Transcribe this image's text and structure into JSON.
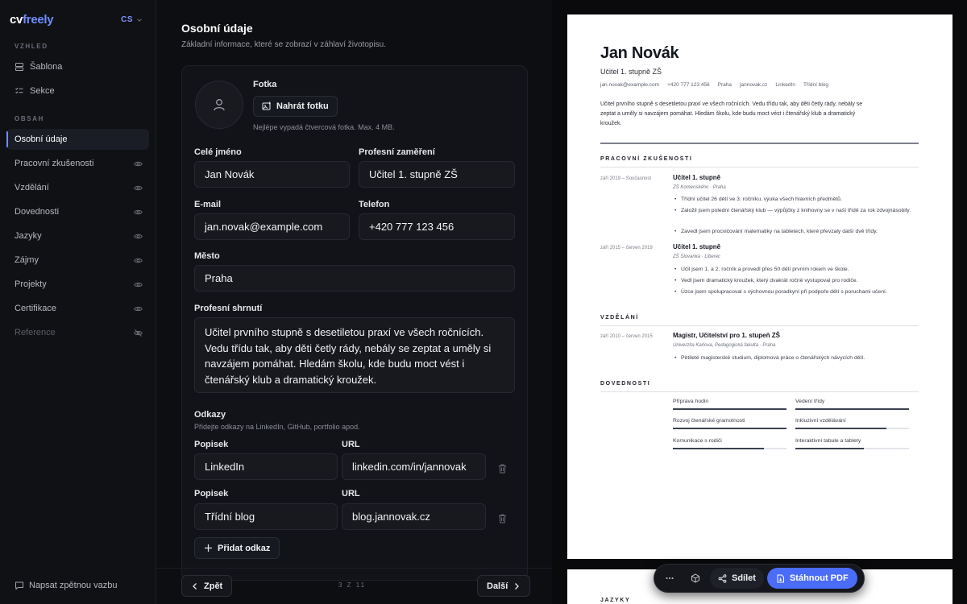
{
  "sidebar": {
    "brand_a": "cv",
    "brand_b": "freely",
    "lang": "CS",
    "section_look": "VZHLED",
    "section_content": "OBSAH",
    "look_items": [
      {
        "label": "Šablona",
        "icon": "layout-icon"
      },
      {
        "label": "Sekce",
        "icon": "list-check-icon"
      }
    ],
    "content_items": [
      {
        "label": "Osobní údaje",
        "active": true
      },
      {
        "label": "Pracovní zkušenosti"
      },
      {
        "label": "Vzdělání"
      },
      {
        "label": "Dovednosti"
      },
      {
        "label": "Jazyky"
      },
      {
        "label": "Zájmy"
      },
      {
        "label": "Projekty"
      },
      {
        "label": "Certifikace"
      },
      {
        "label": "Reference",
        "hidden": true
      }
    ],
    "feedback": "Napsat zpětnou vazbu"
  },
  "editor": {
    "title": "Osobní údaje",
    "subtitle": "Základní informace, které se zobrazí v záhlaví životopisu.",
    "photo_label": "Fotka",
    "upload_label": "Nahrát fotku",
    "photo_hint": "Nejlépe vypadá čtvercová fotka. Max. 4 MB.",
    "full_name_label": "Celé jméno",
    "full_name": "Jan Novák",
    "profession_label": "Profesní zaměření",
    "profession": "Učitel 1. stupně ZŠ",
    "email_label": "E-mail",
    "email": "jan.novak@example.com",
    "phone_label": "Telefon",
    "phone": "+420 777 123 456",
    "city_label": "Město",
    "city": "Praha",
    "summary_label": "Profesní shrnutí",
    "summary": "Učitel prvního stupně s desetiletou praxí ve všech ročnících. Vedu třídu tak, aby děti četly rády, nebály se zeptat a uměly si navzájem pomáhat. Hledám školu, kde budu moct vést i čtenářský klub a dramatický kroužek.",
    "links_title": "Odkazy",
    "links_hint": "Přidejte odkazy na LinkedIn, GitHub, portfolio apod.",
    "link_label_caption": "Popisek",
    "link_url_caption": "URL",
    "links": [
      {
        "label": "LinkedIn",
        "url": "linkedin.com/in/jannovak"
      },
      {
        "label": "Třídní blog",
        "url": "blog.jannovak.cz"
      }
    ],
    "add_link": "Přidat odkaz",
    "prev": "Zpět",
    "next": "Další",
    "pager": "3 Z 11"
  },
  "cv": {
    "name": "Jan Novák",
    "role": "Učitel 1. stupně ZŠ",
    "contacts": [
      "jan.novak@example.com",
      "+420 777 123 456",
      "Praha",
      "jannovak.cz",
      "LinkedIn",
      "Třídní blog"
    ],
    "summary": "Učitel prvního stupně s desetiletou praxí ve všech ročnících. Vedu třídu tak, aby děti četly rády, nebály se zeptat a uměly si navzájem pomáhat. Hledám školu, kde budu moct vést i čtenářský klub a dramatický kroužek.",
    "exp_title": "PRACOVNÍ ZKUŠENOSTI",
    "jobs": [
      {
        "date": "září 2019 – Současnost",
        "title": "Učitel 1. stupně",
        "org": "ZŠ Komenského · Praha",
        "bullets": [
          "Třídní učitel 26 dětí ve 3. ročníku, výuka všech hlavních předmětů.",
          "Založil jsem polední čtenářský klub — výpůjčky z knihovny se v naší třídě za rok zdvojnásobily.",
          "Zavedl jsem procvičování matematiky na tabletech, které převzaly další dvě třídy."
        ]
      },
      {
        "date": "září 2015 – červen 2019",
        "title": "Učitel 1. stupně",
        "org": "ZŠ Slovanka · Liberec",
        "bullets": [
          "Učil jsem 1. a 2. ročník a provedl přes 50 dětí prvním rokem ve škole.",
          "Vedl jsem dramatický kroužek, který dvakrát ročně vystupoval pro rodiče.",
          "Úzce jsem spolupracoval s výchovnou poradkyní při podpoře dětí s poruchami učení."
        ]
      }
    ],
    "edu_title": "VZDĚLÁNÍ",
    "edu": {
      "date": "září 2010 – červen 2015",
      "title": "Magistr, Učitelství pro 1. stupeň ZŠ",
      "org": "Univerzita Karlova, Pedagogická fakulta · Praha",
      "bullet": "Pětileté magisterské studium, diplomová práce o čtenářských návycích dětí."
    },
    "skills_title": "DOVEDNOSTI",
    "skills": [
      {
        "name": "Příprava hodin",
        "level": 1.0
      },
      {
        "name": "Vedení třídy",
        "level": 1.0
      },
      {
        "name": "Rozvoj čtenářské gramotnosti",
        "level": 1.0
      },
      {
        "name": "Inkluzivní vzdělávání",
        "level": 0.8
      },
      {
        "name": "Komunikace s rodiči",
        "level": 0.8
      },
      {
        "name": "Interaktivní tabule a tablety",
        "level": 0.6
      }
    ],
    "lang_title": "JAZYKY"
  },
  "toolbar": {
    "share": "Sdílet",
    "pdf": "Stáhnout PDF"
  },
  "colors": {
    "accent": "#4a6cf7",
    "brand": "#6f8dff"
  }
}
